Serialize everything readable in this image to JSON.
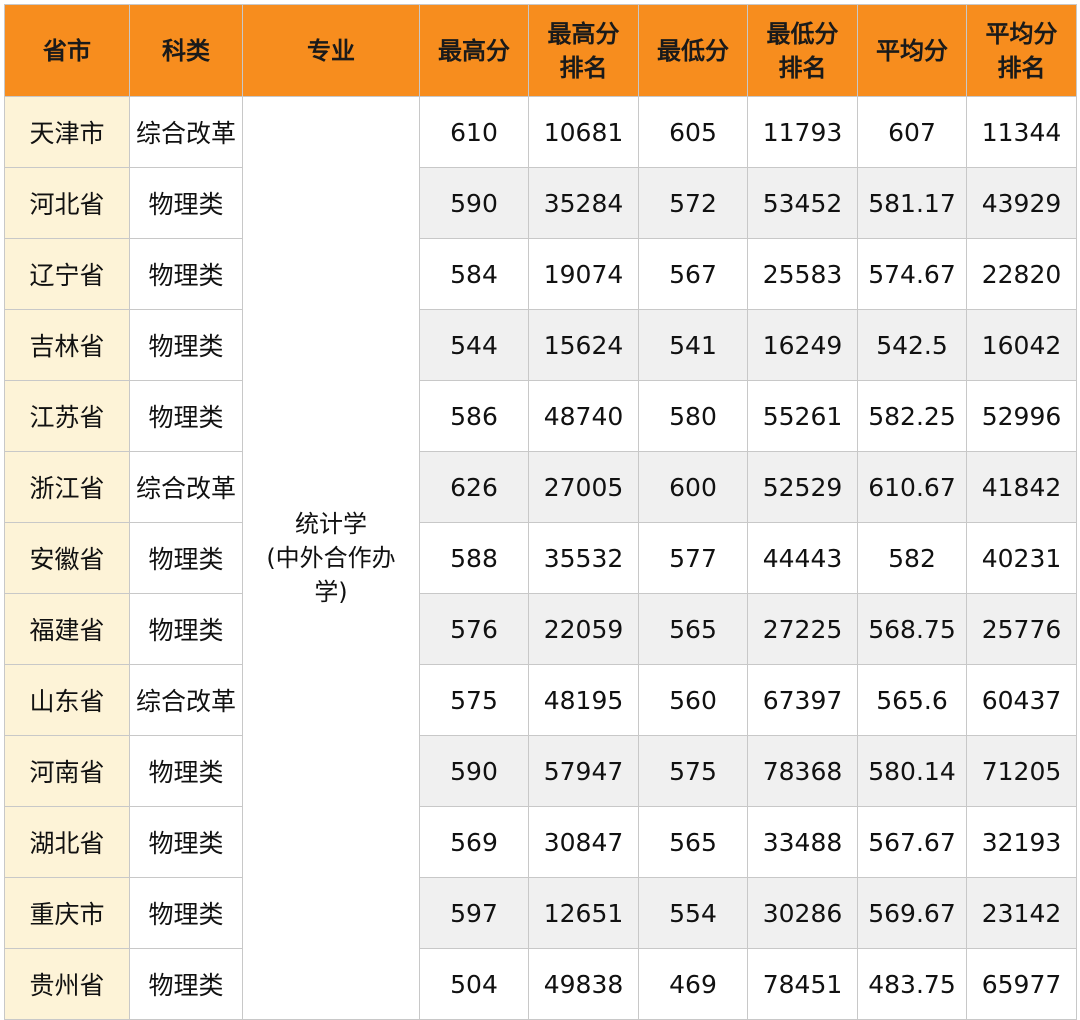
{
  "header": {
    "province": "省市",
    "subject": "科类",
    "major": "专业",
    "max_score": "最高分",
    "max_rank": [
      "最高分",
      "排名"
    ],
    "min_score": "最低分",
    "min_rank": [
      "最低分",
      "排名"
    ],
    "avg_score": "平均分",
    "avg_rank": [
      "平均分",
      "排名"
    ]
  },
  "major_lines": [
    "统计学",
    "(中外合作办",
    "学)"
  ],
  "rows": [
    {
      "province": "天津市",
      "subject": "综合改革",
      "max_score": "610",
      "max_rank": "10681",
      "min_score": "605",
      "min_rank": "11793",
      "avg_score": "607",
      "avg_rank": "11344"
    },
    {
      "province": "河北省",
      "subject": "物理类",
      "max_score": "590",
      "max_rank": "35284",
      "min_score": "572",
      "min_rank": "53452",
      "avg_score": "581.17",
      "avg_rank": "43929"
    },
    {
      "province": "辽宁省",
      "subject": "物理类",
      "max_score": "584",
      "max_rank": "19074",
      "min_score": "567",
      "min_rank": "25583",
      "avg_score": "574.67",
      "avg_rank": "22820"
    },
    {
      "province": "吉林省",
      "subject": "物理类",
      "max_score": "544",
      "max_rank": "15624",
      "min_score": "541",
      "min_rank": "16249",
      "avg_score": "542.5",
      "avg_rank": "16042"
    },
    {
      "province": "江苏省",
      "subject": "物理类",
      "max_score": "586",
      "max_rank": "48740",
      "min_score": "580",
      "min_rank": "55261",
      "avg_score": "582.25",
      "avg_rank": "52996"
    },
    {
      "province": "浙江省",
      "subject": "综合改革",
      "max_score": "626",
      "max_rank": "27005",
      "min_score": "600",
      "min_rank": "52529",
      "avg_score": "610.67",
      "avg_rank": "41842"
    },
    {
      "province": "安徽省",
      "subject": "物理类",
      "max_score": "588",
      "max_rank": "35532",
      "min_score": "577",
      "min_rank": "44443",
      "avg_score": "582",
      "avg_rank": "40231"
    },
    {
      "province": "福建省",
      "subject": "物理类",
      "max_score": "576",
      "max_rank": "22059",
      "min_score": "565",
      "min_rank": "27225",
      "avg_score": "568.75",
      "avg_rank": "25776"
    },
    {
      "province": "山东省",
      "subject": "综合改革",
      "max_score": "575",
      "max_rank": "48195",
      "min_score": "560",
      "min_rank": "67397",
      "avg_score": "565.6",
      "avg_rank": "60437"
    },
    {
      "province": "河南省",
      "subject": "物理类",
      "max_score": "590",
      "max_rank": "57947",
      "min_score": "575",
      "min_rank": "78368",
      "avg_score": "580.14",
      "avg_rank": "71205"
    },
    {
      "province": "湖北省",
      "subject": "物理类",
      "max_score": "569",
      "max_rank": "30847",
      "min_score": "565",
      "min_rank": "33488",
      "avg_score": "567.67",
      "avg_rank": "32193"
    },
    {
      "province": "重庆市",
      "subject": "物理类",
      "max_score": "597",
      "max_rank": "12651",
      "min_score": "554",
      "min_rank": "30286",
      "avg_score": "569.67",
      "avg_rank": "23142"
    },
    {
      "province": "贵州省",
      "subject": "物理类",
      "max_score": "504",
      "max_rank": "49838",
      "min_score": "469",
      "min_rank": "78451",
      "avg_score": "483.75",
      "avg_rank": "65977"
    }
  ],
  "colors": {
    "header_bg": "#f78d1e",
    "province_bg": "#fdf3d7",
    "shaded_row_bg": "#f0f0f0",
    "border": "#c8c8c8"
  }
}
